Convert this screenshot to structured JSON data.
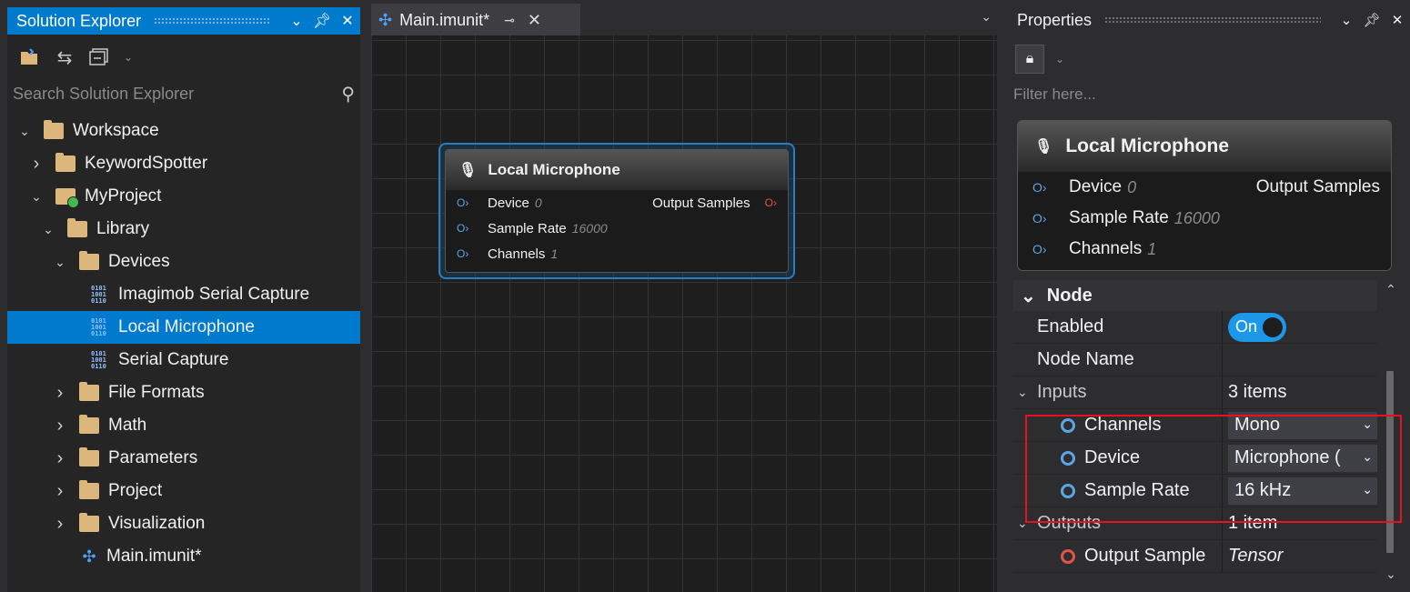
{
  "solution_explorer": {
    "title": "Solution Explorer",
    "search_placeholder": "Search Solution Explorer",
    "tree": [
      {
        "label": "Workspace",
        "level": 0,
        "expanded": true,
        "type": "folder"
      },
      {
        "label": "KeywordSpotter",
        "level": 1,
        "expanded": false,
        "type": "folder"
      },
      {
        "label": "MyProject",
        "level": 1,
        "expanded": true,
        "type": "project"
      },
      {
        "label": "Library",
        "level": 2,
        "expanded": true,
        "type": "folder"
      },
      {
        "label": "Devices",
        "level": 3,
        "expanded": true,
        "type": "folder"
      },
      {
        "label": "Imagimob Serial Capture",
        "level": 4,
        "type": "binary"
      },
      {
        "label": "Local Microphone",
        "level": 4,
        "type": "binary",
        "selected": true
      },
      {
        "label": "Serial Capture",
        "level": 4,
        "type": "binary"
      },
      {
        "label": "File Formats",
        "level": 3,
        "expanded": false,
        "type": "folder"
      },
      {
        "label": "Math",
        "level": 3,
        "expanded": false,
        "type": "folder"
      },
      {
        "label": "Parameters",
        "level": 3,
        "expanded": false,
        "type": "folder"
      },
      {
        "label": "Project",
        "level": 3,
        "expanded": false,
        "type": "folder"
      },
      {
        "label": "Visualization",
        "level": 3,
        "expanded": false,
        "type": "folder"
      },
      {
        "label": "Main.imunit*",
        "level": 3,
        "type": "unit"
      }
    ]
  },
  "editor": {
    "tab_label": "Main.imunit*",
    "node": {
      "title": "Local Microphone",
      "inputs": [
        {
          "name": "Device",
          "value": "0"
        },
        {
          "name": "Sample Rate",
          "value": "16000"
        },
        {
          "name": "Channels",
          "value": "1"
        }
      ],
      "output": "Output Samples"
    }
  },
  "properties": {
    "title": "Properties",
    "filter_placeholder": "Filter here...",
    "card": {
      "title": "Local Microphone",
      "inputs": [
        {
          "name": "Device",
          "value": "0"
        },
        {
          "name": "Sample Rate",
          "value": "16000"
        },
        {
          "name": "Channels",
          "value": "1"
        }
      ],
      "output": "Output Samples"
    },
    "category": "Node",
    "enabled_label": "Enabled",
    "enabled_value": "On",
    "node_name_label": "Node Name",
    "node_name_value": "",
    "inputs_label": "Inputs",
    "inputs_count": "3 items",
    "input_rows": [
      {
        "name": "Channels",
        "value": "Mono"
      },
      {
        "name": "Device",
        "value": "Microphone ("
      },
      {
        "name": "Sample Rate",
        "value": "16 kHz"
      }
    ],
    "outputs_label": "Outputs",
    "outputs_count": "1 item",
    "output_row": {
      "name": "Output Sample",
      "value": "Tensor"
    }
  },
  "colors": {
    "accent": "#007acc",
    "highlight": "#e81123",
    "input_pin": "#5ba4e6",
    "output_pin": "#e0554a"
  }
}
